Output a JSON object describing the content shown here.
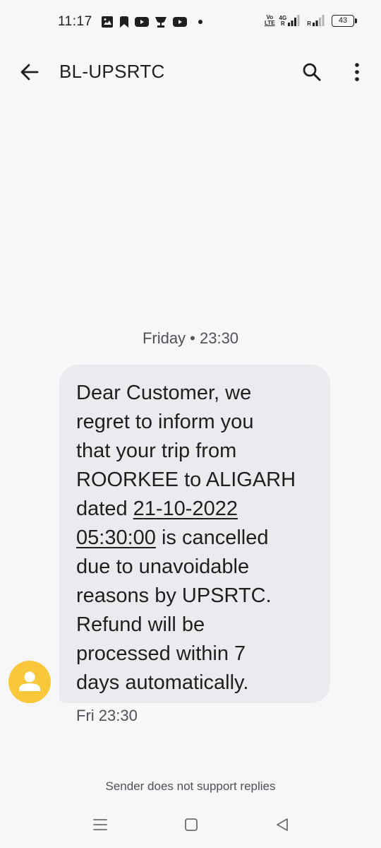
{
  "status_bar": {
    "time": "11:17",
    "left_icons": [
      "image-icon",
      "navigation-icon",
      "youtube-icon",
      "trophy-icon",
      "youtube-icon",
      "dot-icon"
    ],
    "volte_label_top": "Vo",
    "volte_label_bottom": "LTE",
    "network1_label_top": "4G",
    "network1_label_bottom": "R",
    "network2_label": "R",
    "battery_level": "43"
  },
  "app_bar": {
    "title": "BL-UPSRTC",
    "back_icon": "arrow-back-icon",
    "search_icon": "search-icon",
    "more_icon": "more-vert-icon"
  },
  "conversation": {
    "date_divider": "Friday • 23:30",
    "message": {
      "lines": [
        "Dear Customer, we",
        "regret to inform you",
        "that your trip from",
        "ROORKEE to ALIGARH"
      ],
      "line5_prefix": "dated ",
      "line5_link": "21-10-2022",
      "line6_link": "05:30:00",
      "line6_suffix": " is cancelled",
      "lines_after": [
        "due to unavoidable",
        "reasons by UPSRTC.",
        "Refund will be",
        "processed within 7",
        "days automatically."
      ],
      "timestamp": "Fri 23:30"
    },
    "footer_note": "Sender does not support replies"
  },
  "colors": {
    "background": "#f7f7f9",
    "bubble": "#ebebef",
    "avatar": "#f9c83a",
    "text": "#1f1f1f",
    "secondary_text": "#505057"
  },
  "nav_bar": {
    "recents_icon": "menu-icon",
    "home_icon": "square-icon",
    "back_icon": "triangle-back-icon"
  }
}
